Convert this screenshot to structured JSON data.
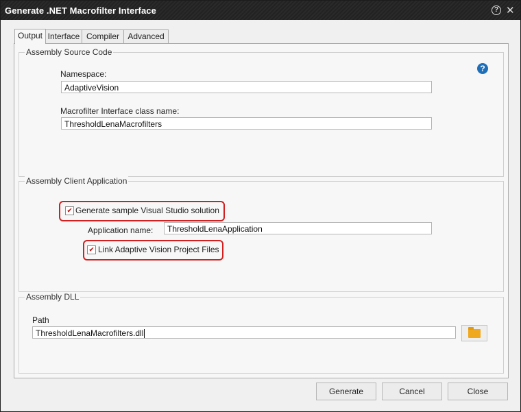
{
  "window": {
    "title": "Generate .NET Macrofilter Interface"
  },
  "tabs": [
    "Output",
    "Interface",
    "Compiler",
    "Advanced"
  ],
  "source_code": {
    "legend": "Assembly Source Code",
    "namespace_label": "Namespace:",
    "namespace_value": "AdaptiveVision",
    "class_label": "Macrofilter Interface class name:",
    "class_value": "ThresholdLenaMacrofilters"
  },
  "client_app": {
    "legend": "Assembly Client Application",
    "generate_label": "Generate sample Visual Studio solution",
    "generate_checked": true,
    "app_name_label": "Application name:",
    "app_name_value": "ThresholdLenaApplication",
    "link_label": "Link Adaptive Vision Project Files",
    "link_checked": true
  },
  "dll": {
    "legend": "Assembly DLL",
    "path_label": "Path",
    "path_value": "ThresholdLenaMacrofilters.dll"
  },
  "buttons": {
    "generate": "Generate",
    "cancel": "Cancel",
    "close": "Close"
  },
  "colors": {
    "highlight": "#d21f1f",
    "folder": "#f0a81f",
    "help": "#1f6fb8"
  }
}
